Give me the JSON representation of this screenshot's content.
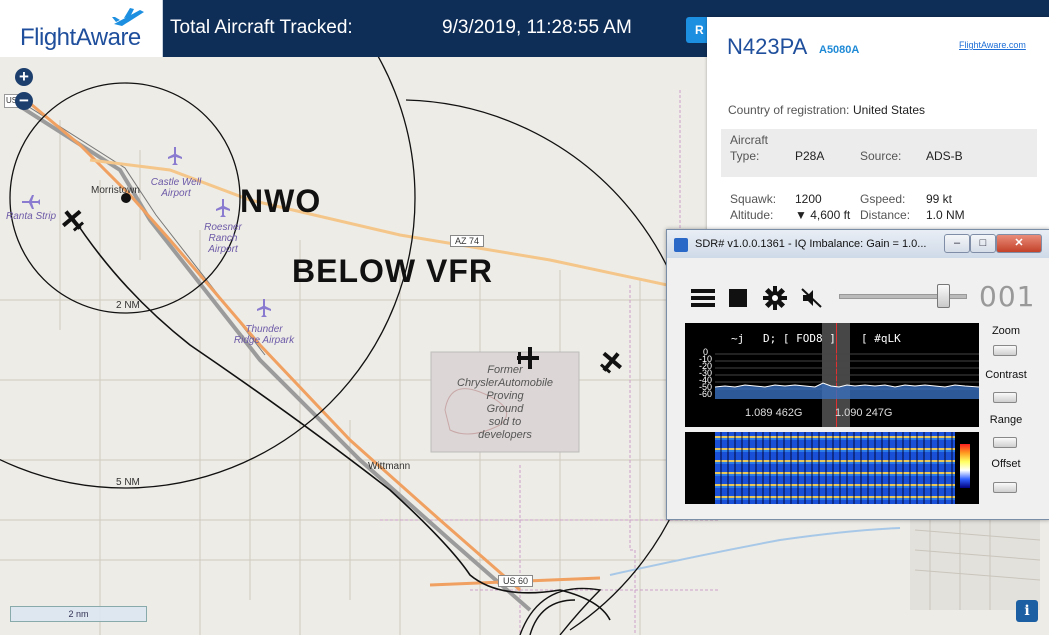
{
  "header": {
    "logo_text": "FlightAware",
    "tracked_label": "Total Aircraft Tracked:",
    "datetime": "9/3/2019, 11:28:55 AM",
    "button_label": "R"
  },
  "map": {
    "overlay_label_1": "NWO",
    "overlay_label_2": "BELOW VFR",
    "places": {
      "morristown": "Morristown",
      "wittmann": "Wittmann",
      "former_line1": "Former",
      "former_line2": "ChryslerAutomobile",
      "former_line3": "Proving",
      "former_line4": "Ground",
      "former_line5": "sold to",
      "former_line6": "developers"
    },
    "airports": {
      "castle_well_1": "Castle Well",
      "castle_well_2": "Airport",
      "roesner_1": "Roesner",
      "roesner_2": "Ranch",
      "roesner_3": "Airport",
      "thunder_1": "Thunder",
      "thunder_2": "Ridge Airpark",
      "ranta": "Ranta Strip"
    },
    "roads": {
      "az74": "AZ 74",
      "us60": "US 60",
      "us_shield": "US"
    },
    "rings": {
      "two_nm": "2 NM",
      "five_nm": "5 NM"
    },
    "scale": "2 nm",
    "zoom_in": "+",
    "zoom_out": "−",
    "info": "i"
  },
  "aircraft": {
    "registration": "N423PA",
    "hex": "A5080A",
    "link": "FlightAware.com",
    "country_label": "Country of registration:",
    "country_value": "United States",
    "aircraft_label": "Aircraft",
    "type_label": "Type:",
    "type_value": "P28A",
    "source_label": "Source:",
    "source_value": "ADS-B",
    "squawk_label": "Squawk:",
    "squawk_value": "1200",
    "gspeed_label": "Gspeed:",
    "gspeed_value": "99 kt",
    "altitude_label": "Altitude:",
    "altitude_value": "▼ 4,600 ft",
    "distance_label": "Distance:",
    "distance_value": "1.0 NM"
  },
  "sdr": {
    "title": "SDR# v1.0.0.1361 - IQ Imbalance: Gain = 1.0...",
    "frequency_display": "001",
    "spectrum_text_1": "~j",
    "spectrum_text_2": "D; [ FOD8 ]",
    "spectrum_text_3": "[ #qLK",
    "db_ticks": [
      "0",
      "-10",
      "-20",
      "-30",
      "-40",
      "-50",
      "-60"
    ],
    "freq_left": "1.089 462G",
    "freq_right": "1.090 247G",
    "zoom_label": "Zoom",
    "contrast_label": "Contrast",
    "range_label": "Range",
    "offset_label": "Offset",
    "minimize": "–",
    "maximize": "□",
    "close": "✕"
  }
}
